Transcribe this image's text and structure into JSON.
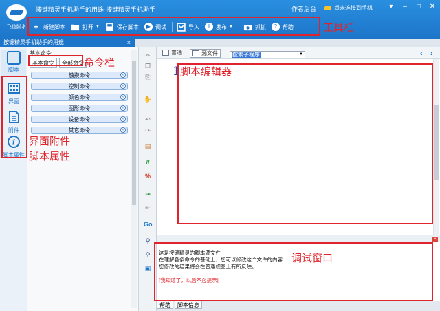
{
  "app": {
    "logo_text": "飞信脚本",
    "title": "按键精灵手机助手的用途-按键精灵手机助手",
    "backend_link": "作者后台",
    "connection_status": "尚未连接到手机"
  },
  "toolbar": {
    "items": [
      {
        "label": "新建脚本",
        "icon": "plus-icon"
      },
      {
        "label": "打开",
        "icon": "folder-icon",
        "dropdown": true
      },
      {
        "label": "保存脚本",
        "icon": "save-icon"
      },
      {
        "label": "调试",
        "icon": "play-icon"
      },
      {
        "label": "导入",
        "icon": "import-icon"
      },
      {
        "label": "发布",
        "icon": "publish-icon",
        "dropdown": true
      },
      {
        "label": "抓抓",
        "icon": "camera-icon"
      },
      {
        "label": "帮助",
        "icon": "help-icon"
      }
    ]
  },
  "document_tab": {
    "label": "按键精灵手机助手的用途"
  },
  "left_nav": {
    "items": [
      {
        "label": "脚本",
        "icon": "script-icon"
      },
      {
        "label": "界面",
        "icon": "ui-grid-icon"
      },
      {
        "label": "附件",
        "icon": "attachment-icon"
      },
      {
        "label": "脚本属性",
        "icon": "info-icon"
      }
    ]
  },
  "command_panel": {
    "title": "基本命令",
    "tabs": [
      "基本命令",
      "全部命令"
    ],
    "groups": [
      "触摸命令",
      "控制命令",
      "颜色命令",
      "图形命令",
      "设备命令",
      "其它命令"
    ]
  },
  "editor": {
    "mode_normal": "普通",
    "mode_source": "源文件",
    "selector_value": "按索子程序",
    "line_numbers": [
      "1"
    ]
  },
  "debug": {
    "lines": [
      "这是按键精灵的脚本源文件",
      "在理解各条命令的基础上，您可以修改这个文件的内容",
      "您修改的结果将会在普通视图上有所反映。"
    ],
    "dismiss_link": "[我知道了，以后不必提示]"
  },
  "bottom_tabs": [
    "帮助",
    "脚本信息"
  ],
  "annotations": {
    "toolbar": "工具栏",
    "command_bar": "命令栏",
    "script_editor": "脚本编辑器",
    "ui_attachment": "界面附件",
    "script_props": "脚本属性",
    "debug_window": "调试窗口"
  },
  "colors": {
    "brand_blue": "#1d75c9",
    "annotation_red": "#e0242b"
  }
}
